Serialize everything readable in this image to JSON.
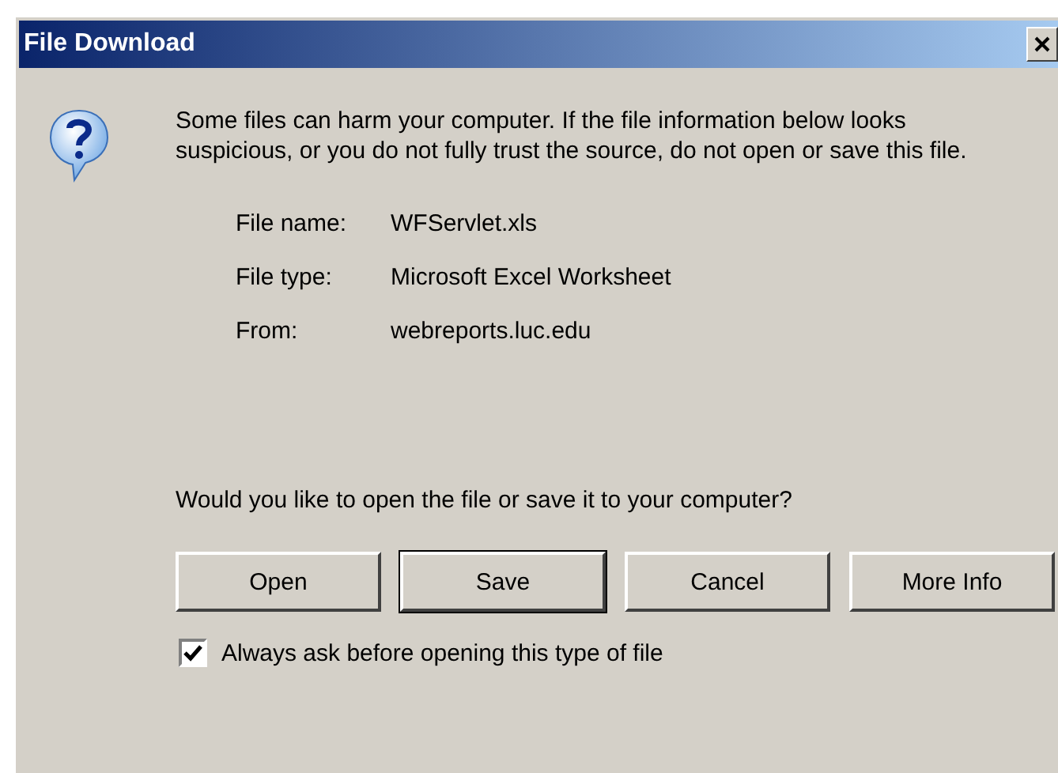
{
  "window": {
    "title": "File Download"
  },
  "message": "Some files can harm your computer. If the file information below looks suspicious, or you do not fully trust the source, do not open or save this file.",
  "file_info": [
    {
      "label": "File name:",
      "value": "WFServlet.xls"
    },
    {
      "label": "File type:",
      "value": "Microsoft Excel Worksheet"
    },
    {
      "label": "From:",
      "value": "webreports.luc.edu"
    }
  ],
  "question": "Would you like to open the file or save it to your computer?",
  "buttons": [
    {
      "label": "Open",
      "default": false
    },
    {
      "label": "Save",
      "default": true
    },
    {
      "label": "Cancel",
      "default": false
    },
    {
      "label": "More Info",
      "default": false
    }
  ],
  "checkbox": {
    "label": "Always ask before opening this type of file",
    "checked": true
  }
}
